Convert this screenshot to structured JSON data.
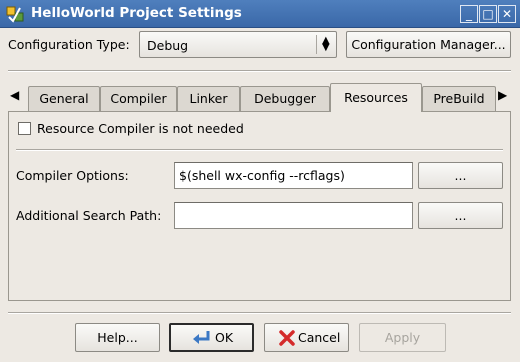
{
  "window": {
    "title": "HelloWorld Project Settings",
    "icon": "app-icon",
    "controls": {
      "minimize": "minimize-icon",
      "maximize": "maximize-icon",
      "close": "close-icon"
    }
  },
  "config": {
    "type_label": "Configuration Type:",
    "type_value": "Debug",
    "manager_button": "Configuration Manager..."
  },
  "tabs": [
    {
      "label": "General",
      "active": false
    },
    {
      "label": "Compiler",
      "active": false
    },
    {
      "label": "Linker",
      "active": false
    },
    {
      "label": "Debugger",
      "active": false
    },
    {
      "label": "Resources",
      "active": true
    },
    {
      "label": "PreBuild",
      "active": false
    }
  ],
  "resources": {
    "not_needed_label": "Resource Compiler is not needed",
    "not_needed_checked": false,
    "compiler_options_label": "Compiler Options:",
    "compiler_options_value": "$(shell wx-config --rcflags)",
    "compiler_options_browse": "...",
    "search_path_label": "Additional Search Path:",
    "search_path_value": "",
    "search_path_browse": "..."
  },
  "footer": {
    "help": "Help...",
    "ok": "OK",
    "cancel": "Cancel",
    "apply": "Apply"
  },
  "colors": {
    "titlebar": "#3f6fb0",
    "dialog": "#ede9e3",
    "cancel_icon": "#d42b2b",
    "ok_icon": "#3b78c4"
  }
}
